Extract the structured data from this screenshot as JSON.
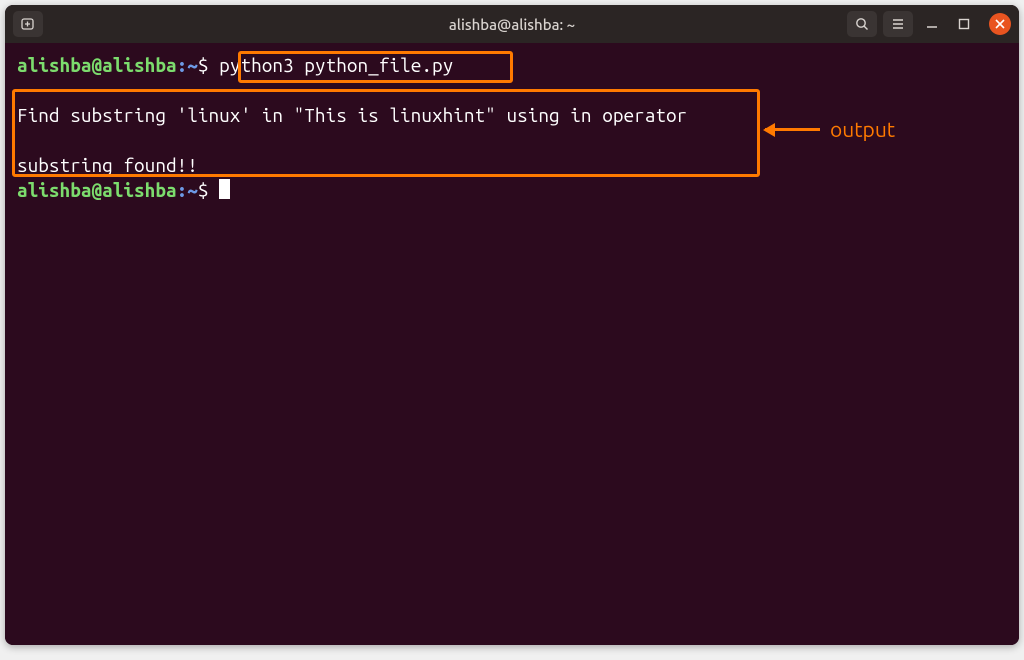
{
  "colors": {
    "accent_orange": "#ff7a00",
    "close_orange": "#e95420",
    "prompt_green": "#7cdc6d",
    "prompt_blue": "#6d9ae6",
    "terminal_bg": "#2c0a1e",
    "titlebar_bg": "#2b2524"
  },
  "titlebar": {
    "title": "alishba@alishba: ~",
    "icons": {
      "new_tab": "new-tab-icon",
      "search": "search-icon",
      "menu": "menu-icon",
      "minimize": "minimize-icon",
      "maximize": "maximize-icon",
      "close": "close-icon"
    }
  },
  "terminal": {
    "prompt": {
      "user_host": "alishba@alishba",
      "sep": ":",
      "path": "~",
      "symbol": "$"
    },
    "command": "python3 python_file.py",
    "output_line1": "Find substring 'linux' in \"This is linuxhint\" using in operator",
    "output_line2": "substring found!!"
  },
  "annotation": {
    "label": "output"
  }
}
